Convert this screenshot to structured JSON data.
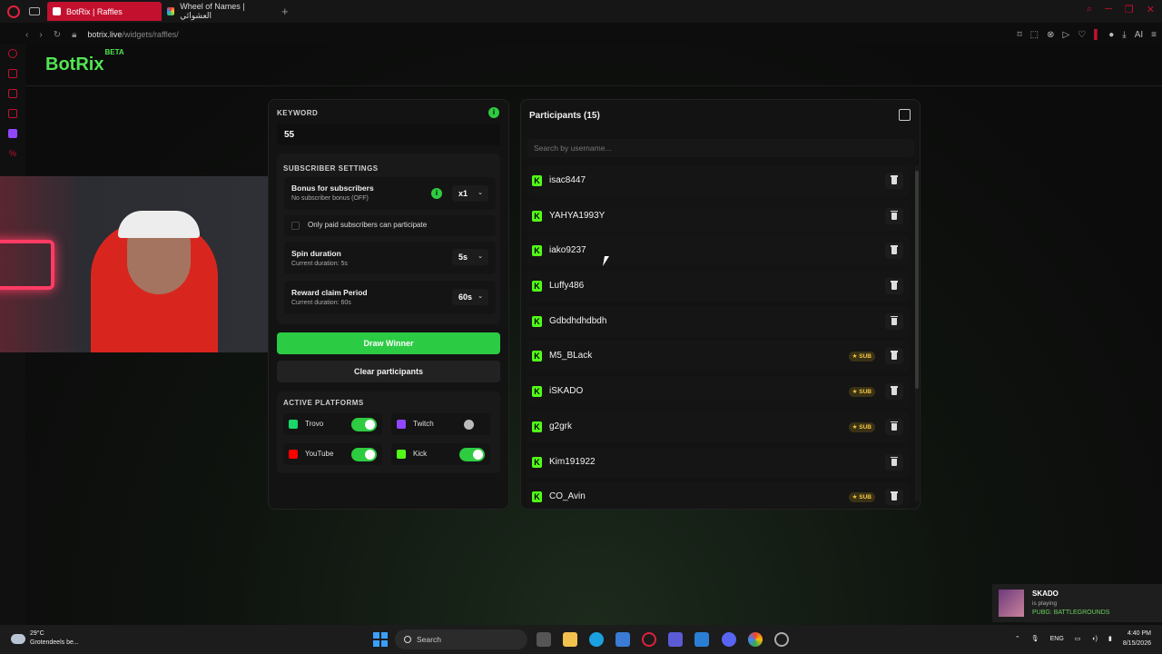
{
  "browser": {
    "tabs": [
      {
        "label": "BotRix | Raffles",
        "active": true
      },
      {
        "label": "Wheel of Names | العشوائي",
        "active": false
      }
    ],
    "url_host": "botrix.live",
    "url_path": "/widgets/raffles/",
    "toolbar_ai": "AI"
  },
  "brand": {
    "logo": "BotRix",
    "badge": "BETA",
    "accent": "#52e552"
  },
  "raffle": {
    "keyword_label": "KEYWORD",
    "keyword_value": "55",
    "subscriber_settings_title": "SUBSCRIBER SETTINGS",
    "bonus_title": "Bonus for subscribers",
    "bonus_sub": "No subscriber bonus (OFF)",
    "bonus_value": "x1",
    "paid_only_label": "Only paid subscribers can participate",
    "spin_title": "Spin duration",
    "spin_sub": "Current duration: 5s",
    "spin_value": "5s",
    "reward_title": "Reward claim Period",
    "reward_sub": "Current duration: 60s",
    "reward_value": "60s",
    "draw_button": "Draw Winner",
    "clear_button": "Clear participants",
    "platforms_title": "ACTIVE PLATFORMS",
    "platforms": [
      {
        "name": "Trovo",
        "enabled": true,
        "color": "#19d66b"
      },
      {
        "name": "Twitch",
        "enabled": false,
        "color": "#9146ff"
      },
      {
        "name": "YouTube",
        "enabled": true,
        "color": "#ff0000"
      },
      {
        "name": "Kick",
        "enabled": true,
        "color": "#53fc18"
      }
    ]
  },
  "participants": {
    "title": "Participants (15)",
    "search_placeholder": "Search by username...",
    "sub_label": "SUB",
    "items": [
      {
        "name": "isac8447",
        "sub": false
      },
      {
        "name": "YAHYA1993Y",
        "sub": false
      },
      {
        "name": "iako9237",
        "sub": false
      },
      {
        "name": "Luffy486",
        "sub": false
      },
      {
        "name": "Gdbdhdhdbdh",
        "sub": false
      },
      {
        "name": "M5_BLack",
        "sub": true
      },
      {
        "name": "iSKADO",
        "sub": true
      },
      {
        "name": "g2grk",
        "sub": true
      },
      {
        "name": "Kim191922",
        "sub": false
      },
      {
        "name": "CO_Avin",
        "sub": true
      }
    ]
  },
  "notification": {
    "user": "SKADO",
    "status": "is playing",
    "game": "PUBG: BATTLEGROUNDS"
  },
  "taskbar": {
    "temp": "29°C",
    "weather": "Grotendeels be...",
    "search": "Search",
    "lang": "ENG",
    "time": "4:40 PM",
    "date": "8/15/2026"
  }
}
